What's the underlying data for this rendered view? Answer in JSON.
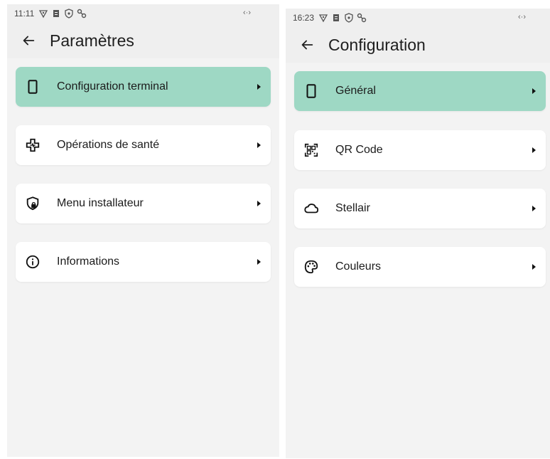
{
  "left_screen": {
    "status": {
      "time": "11:11",
      "net": "‹·›"
    },
    "title": "Paramètres",
    "items": [
      {
        "label": "Configuration terminal",
        "icon": "phone-icon",
        "active": true
      },
      {
        "label": "Opérations de santé",
        "icon": "medical-cross-icon",
        "active": false
      },
      {
        "label": "Menu installateur",
        "icon": "shield-lock-icon",
        "active": false
      },
      {
        "label": "Informations",
        "icon": "info-icon",
        "active": false
      }
    ]
  },
  "right_screen": {
    "status": {
      "time": "16:23",
      "net": "‹·›"
    },
    "title": "Configuration",
    "items": [
      {
        "label": "Général",
        "icon": "phone-icon",
        "active": true
      },
      {
        "label": "QR Code",
        "icon": "qr-code-icon",
        "active": false
      },
      {
        "label": "Stellair",
        "icon": "cloud-icon",
        "active": false
      },
      {
        "label": "Couleurs",
        "icon": "palette-icon",
        "active": false
      }
    ]
  },
  "colors": {
    "accent": "#9ed8c4",
    "background": "#efefef",
    "card": "#ffffff"
  }
}
